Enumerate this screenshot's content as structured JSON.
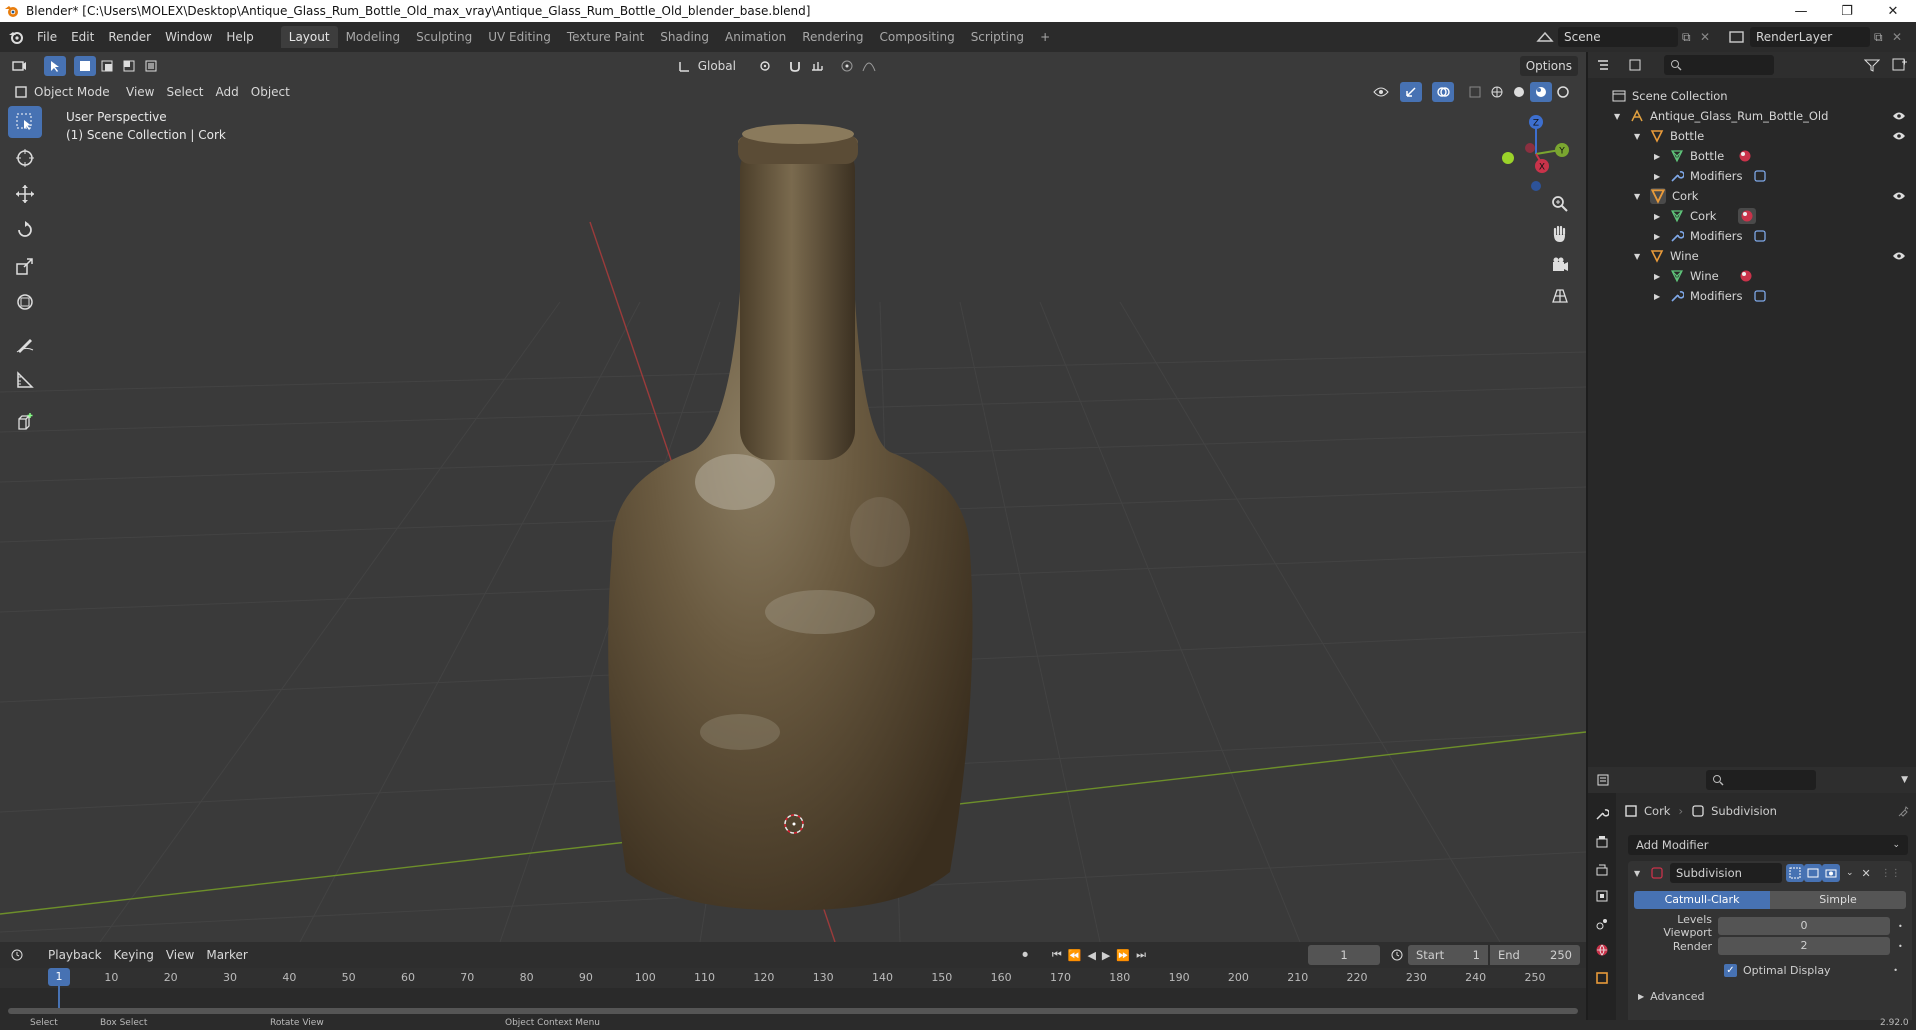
{
  "window": {
    "title": "Blender* [C:\\Users\\MOLEX\\Desktop\\Antique_Glass_Rum_Bottle_Old_max_vray\\Antique_Glass_Rum_Bottle_Old_blender_base.blend]",
    "minimize": "—",
    "maximize": "❐",
    "close": "✕"
  },
  "menu": [
    "File",
    "Edit",
    "Render",
    "Window",
    "Help"
  ],
  "workspaces": [
    {
      "label": "Layout",
      "active": true
    },
    {
      "label": "Modeling",
      "active": false
    },
    {
      "label": "Sculpting",
      "active": false
    },
    {
      "label": "UV Editing",
      "active": false
    },
    {
      "label": "Texture Paint",
      "active": false
    },
    {
      "label": "Shading",
      "active": false
    },
    {
      "label": "Animation",
      "active": false
    },
    {
      "label": "Rendering",
      "active": false
    },
    {
      "label": "Compositing",
      "active": false
    },
    {
      "label": "Scripting",
      "active": false
    }
  ],
  "add_workspace": "+",
  "scene": {
    "name": "Scene",
    "render_layer": "RenderLayer"
  },
  "viewport": {
    "header": {
      "mode": "Object Mode",
      "menus": [
        "View",
        "Select",
        "Add",
        "Object"
      ],
      "orientation": "Global",
      "options": "Options"
    },
    "overlay_line1": "User Perspective",
    "overlay_line2": "(1) Scene Collection | Cork",
    "gizmo": {
      "x": "X",
      "y": "Y",
      "z": "Z"
    },
    "colors": {
      "bg": "#3a3a3a",
      "grid": "#454545",
      "x_axis": "#9b3b3b",
      "y_axis": "#6d8f2a"
    }
  },
  "outliner": {
    "root": "Scene Collection",
    "collection": "Antique_Glass_Rum_Bottle_Old",
    "objects": [
      {
        "name": "Bottle",
        "mesh": "Bottle",
        "modifiers": "Modifiers"
      },
      {
        "name": "Cork",
        "mesh": "Cork",
        "modifiers": "Modifiers"
      },
      {
        "name": "Wine",
        "mesh": "Wine",
        "modifiers": "Modifiers"
      }
    ]
  },
  "properties": {
    "object": "Cork",
    "modifier_crumb": "Subdivision",
    "add_modifier": "Add Modifier",
    "modifier_name": "Subdivision",
    "type_catmull": "Catmull-Clark",
    "type_simple": "Simple",
    "levels_viewport_label": "Levels Viewport",
    "levels_viewport_value": "0",
    "render_label": "Render",
    "render_value": "2",
    "optimal_display": "Optimal Display",
    "advanced": "Advanced"
  },
  "timeline": {
    "menus": [
      "Playback",
      "Keying",
      "View",
      "Marker"
    ],
    "current_frame": "1",
    "start_label": "Start",
    "start": "1",
    "end_label": "End",
    "end": "250",
    "ticks": [
      "1",
      "10",
      "20",
      "30",
      "40",
      "50",
      "60",
      "70",
      "80",
      "90",
      "100",
      "110",
      "120",
      "130",
      "140",
      "150",
      "160",
      "170",
      "180",
      "190",
      "200",
      "210",
      "220",
      "230",
      "240",
      "250"
    ]
  },
  "status": {
    "select": "Select",
    "box_select": "Box Select",
    "rotate_view": "Rotate View",
    "context_menu": "Object Context Menu",
    "version": "2.92.0"
  }
}
